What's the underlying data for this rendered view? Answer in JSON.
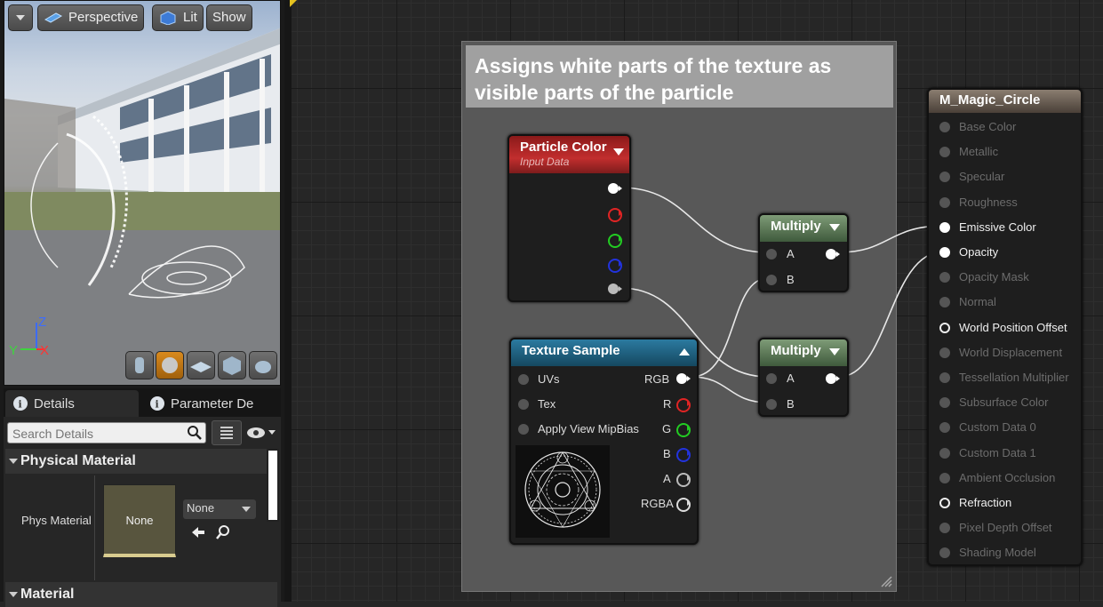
{
  "viewport": {
    "toolbar": {
      "perspective": "Perspective",
      "lit": "Lit",
      "show": "Show"
    },
    "axes": {
      "z": "Z",
      "x": "X",
      "y": "Y"
    }
  },
  "details": {
    "tabs": [
      "Details",
      "Parameter De"
    ],
    "search_placeholder": "Search Details",
    "sections": {
      "physical": "Physical Material",
      "material": "Material"
    },
    "phys_material": {
      "label": "Phys Material",
      "thumb": "None",
      "dropdown": "None"
    }
  },
  "graph": {
    "comment": "Assigns white parts of the texture as visible parts of the particle",
    "particle_color": {
      "title": "Particle Color",
      "subtitle": "Input Data"
    },
    "texture_sample": {
      "title": "Texture Sample",
      "inputs": [
        "UVs",
        "Tex",
        "Apply View MipBias"
      ],
      "outputs": [
        "RGB",
        "R",
        "G",
        "B",
        "A",
        "RGBA"
      ]
    },
    "multiply": {
      "title": "Multiply",
      "inputs": [
        "A",
        "B"
      ]
    },
    "result": {
      "title": "M_Magic_Circle",
      "inputs": [
        {
          "label": "Base Color",
          "active": false
        },
        {
          "label": "Metallic",
          "active": false
        },
        {
          "label": "Specular",
          "active": false
        },
        {
          "label": "Roughness",
          "active": false
        },
        {
          "label": "Emissive Color",
          "active": true
        },
        {
          "label": "Opacity",
          "active": true
        },
        {
          "label": "Opacity Mask",
          "active": false
        },
        {
          "label": "Normal",
          "active": false
        },
        {
          "label": "World Position Offset",
          "active": true
        },
        {
          "label": "World Displacement",
          "active": false
        },
        {
          "label": "Tessellation Multiplier",
          "active": false
        },
        {
          "label": "Subsurface Color",
          "active": false
        },
        {
          "label": "Custom Data 0",
          "active": false
        },
        {
          "label": "Custom Data 1",
          "active": false
        },
        {
          "label": "Ambient Occlusion",
          "active": false
        },
        {
          "label": "Refraction",
          "active": true
        },
        {
          "label": "Pixel Depth Offset",
          "active": false
        },
        {
          "label": "Shading Model",
          "active": false
        }
      ]
    }
  },
  "colors": {
    "particle_header": "#8b1a1a",
    "texture_header": "#1e5f7a",
    "multiply_header": "#5f7a5a",
    "result_header": "#6e6258"
  }
}
